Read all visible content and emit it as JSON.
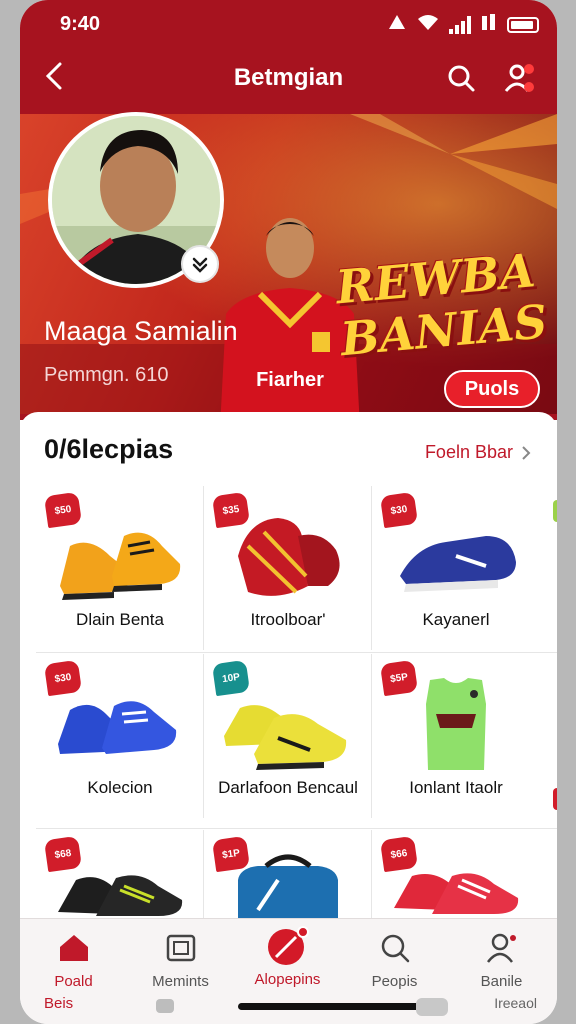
{
  "status": {
    "time": "9:40"
  },
  "header": {
    "title": "Betmgian"
  },
  "banner": {
    "promo_title": "REWBA BANIAS",
    "promo_button": "Puols",
    "jersey_text": "Fiarher",
    "profile_name": "Maaga Samialin",
    "profile_sub": "Pemmgn. 610"
  },
  "section": {
    "title": "0/6lecpias",
    "see_all": "Foeln Bbar"
  },
  "products": [
    {
      "name": "Dlain Benta",
      "price": "$50",
      "tag_color": "#d11d2a",
      "image": "shoe-orange"
    },
    {
      "name": "Itroolboar'",
      "price": "$35",
      "tag_color": "#d11d2a",
      "image": "bag-red"
    },
    {
      "name": "Kayanerl",
      "price": "$30",
      "tag_color": "#d11d2a",
      "image": "shoe-navy"
    },
    {
      "name": "Kolecion",
      "price": "$30",
      "tag_color": "#d11d2a",
      "image": "shoe-blue"
    },
    {
      "name": "Darlafoon Bencaul",
      "price": "10P",
      "tag_color": "#17908e",
      "image": "shoe-yellow"
    },
    {
      "name": "Ionlant Itaolr",
      "price": "$5P",
      "tag_color": "#d11d2a",
      "image": "jersey-green"
    },
    {
      "name": "",
      "price": "$68",
      "tag_color": "#d11d2a",
      "image": "shoe-black"
    },
    {
      "name": "",
      "price": "$1P",
      "tag_color": "#d11d2a",
      "image": "bag-blue"
    },
    {
      "name": "",
      "price": "$66",
      "tag_color": "#d11d2a",
      "image": "shoe-red"
    }
  ],
  "bottom_nav": {
    "tabs": [
      {
        "label": "Poald",
        "icon": "home-icon",
        "active": true
      },
      {
        "label": "Memints",
        "icon": "gallery-icon",
        "active": false
      },
      {
        "label": "Alopepins",
        "icon": "ball-icon",
        "active": true
      },
      {
        "label": "Peopis",
        "icon": "search-icon",
        "active": false
      },
      {
        "label": "Banile",
        "icon": "profile-icon",
        "active": false
      }
    ],
    "extra_left": "Beis",
    "extra_right": "Ireeaol"
  },
  "colors": {
    "brand": "#a7131f",
    "accent": "#c0192a",
    "promo_text": "#ffd23a"
  }
}
